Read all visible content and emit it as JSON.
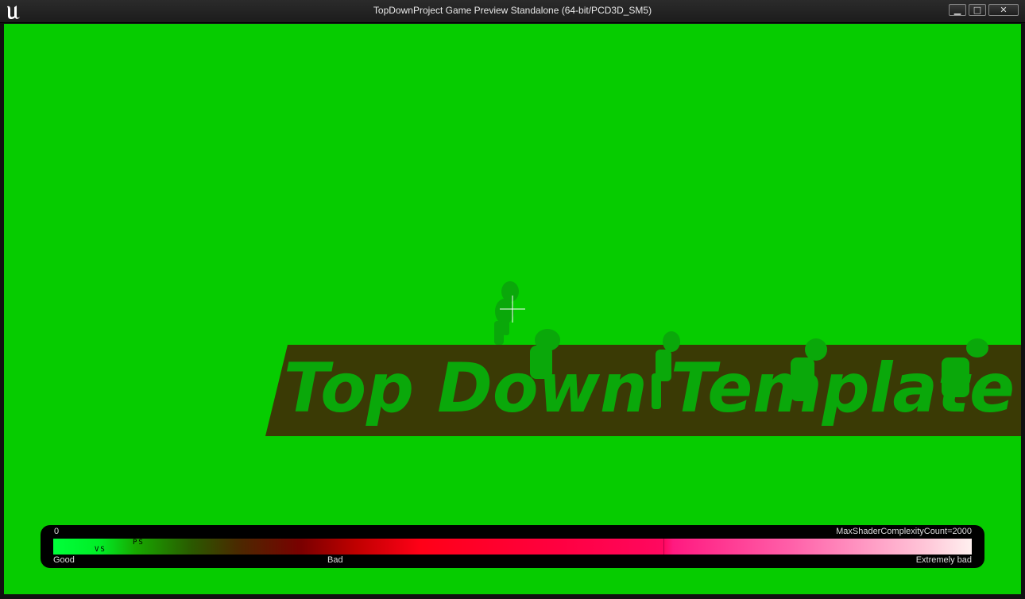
{
  "window": {
    "title": "TopDownProject Game Preview Standalone (64-bit/PCD3D_SM5)",
    "buttons": {
      "minimize": "▁",
      "maximize": "□",
      "close": "✕"
    }
  },
  "scene": {
    "banner_text": "Top Down Template",
    "background_color": "#06cc00",
    "banner_color": "#3a3a05",
    "text_color": "#0aa80a"
  },
  "legend": {
    "min_value": "0",
    "max_label": "MaxShaderComplexityCount=2000",
    "good_label": "Good",
    "bad_label": "Bad",
    "extreme_label": "Extremely bad",
    "vs_marker": "VS",
    "ps_marker": "PS"
  },
  "icons": {
    "app": "unreal-engine-logo-icon",
    "cursor": "crosshair-icon"
  }
}
